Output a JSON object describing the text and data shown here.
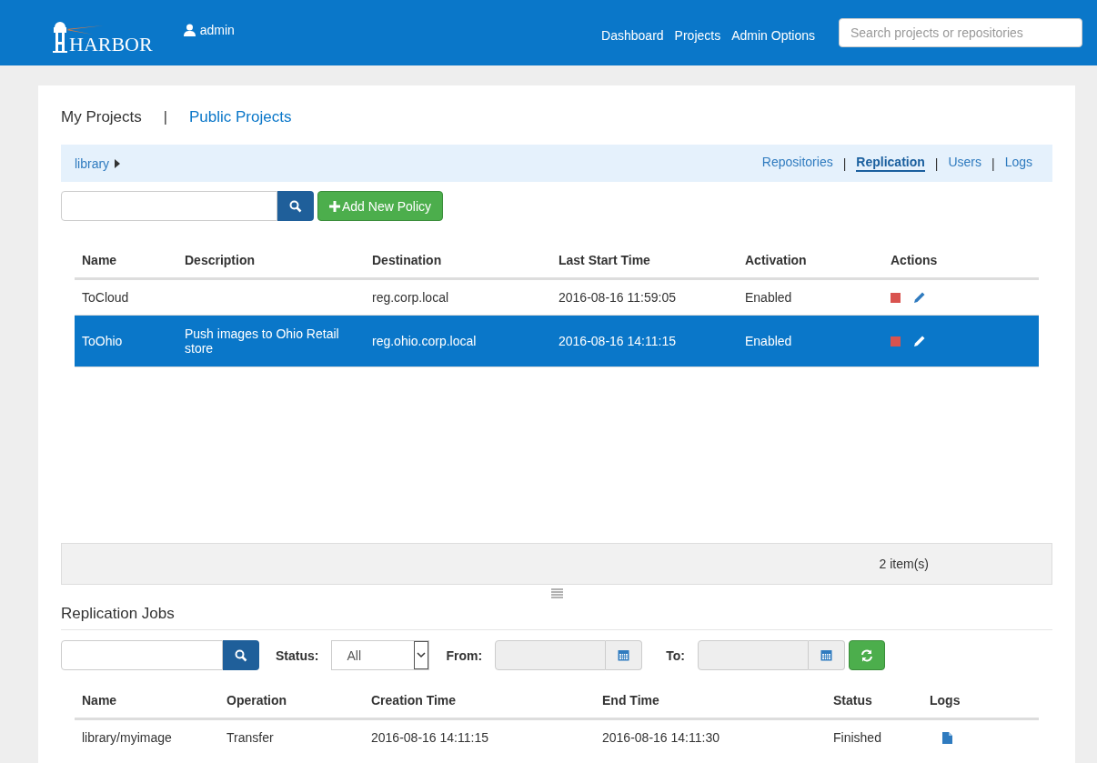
{
  "header": {
    "logo": "HARBOR",
    "user": "admin",
    "nav": [
      "Dashboard",
      "Projects",
      "Admin Options"
    ],
    "search": {
      "placeholder": "Search projects or repositories"
    }
  },
  "project_tabs": [
    {
      "label": "My Projects",
      "selected": true
    },
    {
      "label": "Public Projects",
      "selected": false
    }
  ],
  "project_tabs_separator": "|",
  "breadcrumb": "library",
  "subnav": [
    {
      "label": "Repositories",
      "selected": false
    },
    {
      "label": "Replication",
      "selected": true
    },
    {
      "label": "Users",
      "selected": false
    },
    {
      "label": "Logs",
      "selected": false
    }
  ],
  "subnav_separator": "|",
  "add_button": "Add New Policy",
  "policies": {
    "columns": [
      "Name",
      "Description",
      "Destination",
      "Last Start Time",
      "Activation",
      "Actions"
    ],
    "rows": [
      {
        "name": "ToCloud",
        "description": "",
        "destination": "reg.corp.local",
        "last_start": "2016-08-16 11:59:05",
        "activation": "Enabled",
        "selected": false
      },
      {
        "name": "ToOhio",
        "description": "Push images to Ohio Retail store",
        "destination": "reg.ohio.corp.local",
        "last_start": "2016-08-16 14:11:15",
        "activation": "Enabled",
        "selected": true
      }
    ],
    "count": "2 item(s)"
  },
  "jobs": {
    "title": "Replication Jobs",
    "status_label": "Status:",
    "status_value": "All",
    "from_label": "From:",
    "to_label": "To:",
    "columns": [
      "Name",
      "Operation",
      "Creation Time",
      "End Time",
      "Status",
      "Logs"
    ],
    "rows": [
      {
        "name": "library/myimage",
        "operation": "Transfer",
        "created": "2016-08-16 14:11:15",
        "ended": "2016-08-16 14:11:30",
        "status": "Finished"
      }
    ]
  }
}
